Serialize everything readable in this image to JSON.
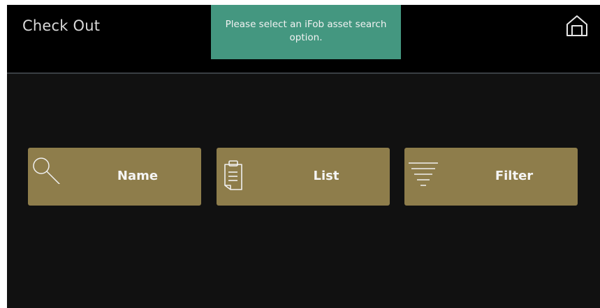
{
  "header": {
    "title": "Check Out"
  },
  "toast": {
    "message": "Please select an iFob asset search option."
  },
  "home": {
    "icon": "home-icon"
  },
  "search_options": [
    {
      "label": "Name",
      "icon": "search-icon"
    },
    {
      "label": "List",
      "icon": "clipboard-icon"
    },
    {
      "label": "Filter",
      "icon": "filter-icon"
    }
  ],
  "colors": {
    "background": "#111111",
    "header": "#000000",
    "toast": "#449780",
    "button": "#8e7d4b",
    "text": "#f5f5f5"
  }
}
